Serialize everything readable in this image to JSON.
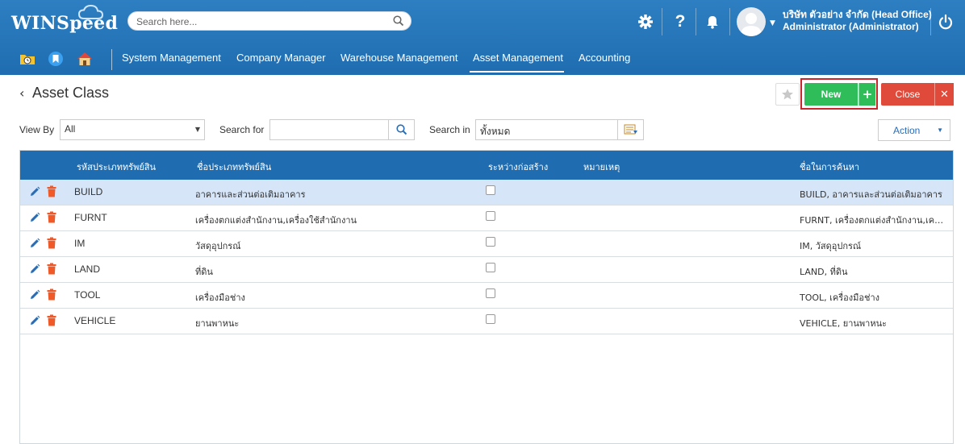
{
  "app": {
    "logo_text": "WINSpeed"
  },
  "header": {
    "search_placeholder": "Search here...",
    "company": "บริษัท ตัวอย่าง จำกัด (Head Office)",
    "user": "Administrator (Administrator)"
  },
  "nav": {
    "items": [
      "System Management",
      "Company Manager",
      "Warehouse Management",
      "Asset Management",
      "Accounting"
    ],
    "active": "Asset Management"
  },
  "page": {
    "title": "Asset Class",
    "new_label": "New",
    "new_plus": "+",
    "close_label": "Close",
    "close_x": "✕"
  },
  "filters": {
    "view_by_label": "View By",
    "view_by_value": "All",
    "search_for_label": "Search for",
    "search_for_value": "",
    "search_in_label": "Search in",
    "search_in_value": "ทั้งหมด",
    "action_label": "Action"
  },
  "table": {
    "columns": [
      "รหัสประเภททรัพย์สิน",
      "ชื่อประเภททรัพย์สิน",
      "ระหว่างก่อสร้าง",
      "หมายเหตุ",
      "ชื่อในการค้นหา"
    ],
    "rows": [
      {
        "code": "BUILD",
        "name": "อาคารและส่วนต่อเติมอาคาร",
        "construction": false,
        "note": "",
        "search_name": "BUILD, อาคารและส่วนต่อเติมอาคาร"
      },
      {
        "code": "FURNT",
        "name": "เครื่องตกแต่งสำนักงาน,เครื่องใช้สำนักงาน",
        "construction": false,
        "note": "",
        "search_name": "FURNT, เครื่องตกแต่งสำนักงาน,เครื่องใช้สำนักงาน"
      },
      {
        "code": "IM",
        "name": "วัสดุอุปกรณ์",
        "construction": false,
        "note": "",
        "search_name": "IM, วัสดุอุปกรณ์"
      },
      {
        "code": "LAND",
        "name": "ที่ดิน",
        "construction": false,
        "note": "",
        "search_name": "LAND, ที่ดิน"
      },
      {
        "code": "TOOL",
        "name": "เครื่องมือช่าง",
        "construction": false,
        "note": "",
        "search_name": "TOOL, เครื่องมือช่าง"
      },
      {
        "code": "VEHICLE",
        "name": "ยานพาหนะ",
        "construction": false,
        "note": "",
        "search_name": "VEHICLE, ยานพาหนะ"
      }
    ]
  },
  "colors": {
    "header_blue": "#1f6db0",
    "new_green": "#2ebd59",
    "close_red": "#e04a3a",
    "selected_row": "#d6e5f7",
    "highlight_red": "#c9252c"
  }
}
